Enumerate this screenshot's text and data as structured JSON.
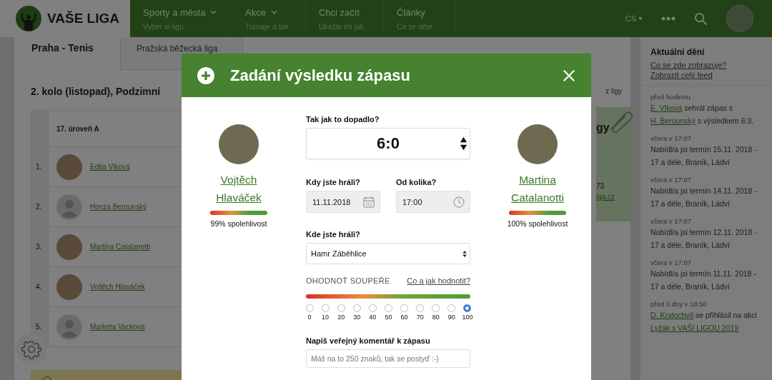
{
  "header": {
    "logo_text": "VAŠE LIGA",
    "nav": [
      {
        "label": "Sporty a města",
        "sublabel": "Vyber si ligu",
        "dropdown": true
      },
      {
        "label": "Akce",
        "sublabel": "Turnaje a tak",
        "dropdown": true
      },
      {
        "label": "Chci začít",
        "sublabel": "Ukažte mi jak",
        "dropdown": false
      },
      {
        "label": "Články",
        "sublabel": "Co se děje",
        "dropdown": false
      }
    ],
    "language": "CS"
  },
  "page": {
    "tabs": [
      {
        "label": "Praha - Tenis",
        "selected": true
      },
      {
        "label": "Pražská běžecká liga",
        "selected": false
      }
    ],
    "round_title": "2. kolo (listopad), Podzimní",
    "side_link": "z ligy",
    "table": {
      "header": "17. úroveň A",
      "rows": [
        {
          "rank": "1.",
          "name": "Edita Vlková",
          "kind": "photo"
        },
        {
          "rank": "2.",
          "name": "Honza Berounský",
          "kind": "placeholder"
        },
        {
          "rank": "3.",
          "name": "Martina Catalanotti",
          "kind": "photo"
        },
        {
          "rank": "4.",
          "name": "Vojtěch Hlaváček",
          "kind": "photo"
        },
        {
          "rank": "5.",
          "name": "Marketa Vackova",
          "kind": "placeholder"
        }
      ]
    },
    "note": {
      "heading": "gy",
      "phone": "73",
      "link": "iga.cz"
    }
  },
  "modal": {
    "title": "Zadání výsledku zápasu",
    "players": [
      {
        "name": "Vojtěch Hlaváček",
        "reliability": "99% spolehlivost"
      },
      {
        "name": "Martina Catalanotti",
        "reliability": "100% spolehlivost"
      }
    ],
    "score_label": "Tak jak to dopadlo?",
    "score": "6:0",
    "date_label": "Kdy jste hráli?",
    "date": "11.11.2018",
    "time_label": "Od kolika?",
    "time": "17:00",
    "place_label": "Kde jste hráli?",
    "place": "Hamr Záběhlice",
    "rating_label": "OHODNOŤ SOUPEŘE",
    "rating_help": "Co a jak hodnotit?",
    "rating_options": [
      {
        "label": "0",
        "selected": false
      },
      {
        "label": "10",
        "selected": false
      },
      {
        "label": "20",
        "selected": false
      },
      {
        "label": "30",
        "selected": false
      },
      {
        "label": "40",
        "selected": false
      },
      {
        "label": "50",
        "selected": false
      },
      {
        "label": "60",
        "selected": false
      },
      {
        "label": "70",
        "selected": false
      },
      {
        "label": "80",
        "selected": false
      },
      {
        "label": "90",
        "selected": false
      },
      {
        "label": "100",
        "selected": true
      }
    ],
    "comment_label": "Napiš veřejný komentář k zápasu",
    "comment_placeholder": "Máš na to 250 znaků, tak se postyď :-)"
  },
  "feed": {
    "title": "Aktuální dění",
    "links": [
      "Co se zde zobrazuje?",
      "Zobrazit celý feed"
    ],
    "items": [
      {
        "time": "před hodinou",
        "parts": [
          {
            "text": "E. Vlková",
            "link": true
          },
          {
            "text": " sehrál zápas s ",
            "link": false
          },
          {
            "text": "H. Berounský",
            "link": true
          },
          {
            "text": " s výsledkem 6:3.",
            "link": false
          }
        ]
      },
      {
        "time": "včera v 17:07",
        "parts": [
          {
            "text": "Nabídl/a jsi termín 15.11. 2018 - 17 a déle, Braník, Ládví",
            "link": false
          }
        ]
      },
      {
        "time": "včera v 17:07",
        "parts": [
          {
            "text": "Nabídl/a jsi termín 14.11. 2018 - 17 a déle, Braník, Ládví",
            "link": false
          }
        ]
      },
      {
        "time": "včera v 17:07",
        "parts": [
          {
            "text": "Nabídl/a jsi termín 12.11. 2018 - 17 a déle, Braník, Ládví",
            "link": false
          }
        ]
      },
      {
        "time": "včera v 17:07",
        "parts": [
          {
            "text": "Nabídl/a jsi termín 11.11. 2018 - 17 a déle, Braník, Ládví",
            "link": false
          }
        ]
      },
      {
        "time": "před 3 dny v 18:50",
        "parts": [
          {
            "text": "D. Kratochvíl",
            "link": true
          },
          {
            "text": " se přihlásil na akci ",
            "link": false
          },
          {
            "text": "Lyžák s VAŠÍ LIGOU 2019",
            "link": true
          }
        ]
      }
    ]
  }
}
